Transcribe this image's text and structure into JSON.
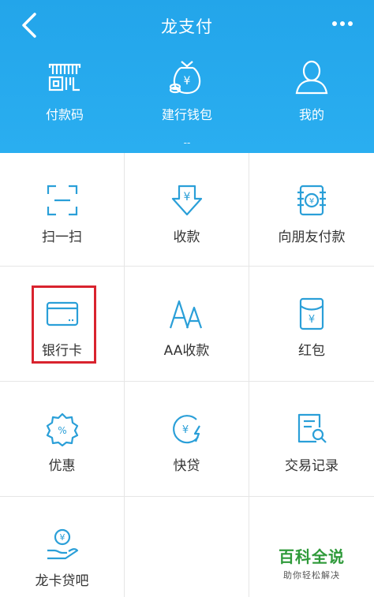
{
  "header": {
    "title": "龙支付",
    "items": [
      {
        "label": "付款码",
        "icon": "barcode-qr-icon"
      },
      {
        "label": "建行钱包",
        "icon": "money-bag-icon",
        "sub": "--"
      },
      {
        "label": "我的",
        "icon": "person-icon"
      }
    ],
    "color": "#26a9ee"
  },
  "grid": {
    "cells": [
      {
        "label": "扫一扫",
        "icon": "scan-icon"
      },
      {
        "label": "收款",
        "icon": "receive-payment-icon"
      },
      {
        "label": "向朋友付款",
        "icon": "pay-friend-icon"
      },
      {
        "label": "银行卡",
        "icon": "bank-card-icon"
      },
      {
        "label": "AA收款",
        "icon": "aa-split-icon"
      },
      {
        "label": "红包",
        "icon": "red-packet-icon"
      },
      {
        "label": "优惠",
        "icon": "discount-badge-icon"
      },
      {
        "label": "快贷",
        "icon": "quick-loan-icon"
      },
      {
        "label": "交易记录",
        "icon": "transaction-record-icon"
      },
      {
        "label": "龙卡贷吧",
        "icon": "card-loan-icon"
      }
    ],
    "icon_color": "#2a9fd8"
  },
  "watermark": {
    "title": "百科全说",
    "subtitle": "助你轻松解决"
  }
}
